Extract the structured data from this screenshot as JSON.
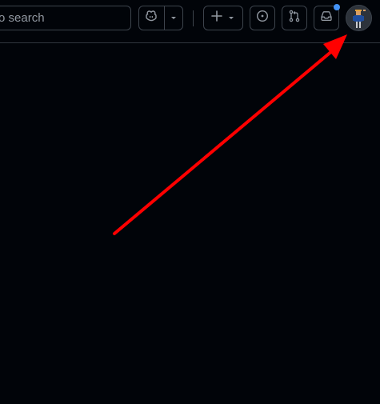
{
  "header": {
    "search": {
      "visible_text": "o search"
    },
    "buttons": {
      "copilot_icon": "copilot-icon",
      "copilot_menu_icon": "triangle-down-icon",
      "create_icon": "plus-icon",
      "create_menu_icon": "triangle-down-icon",
      "issues_icon": "issue-opened-icon",
      "pull_requests_icon": "git-pull-request-icon",
      "inbox_icon": "inbox-icon"
    },
    "notification_indicator": true
  },
  "colors": {
    "background": "#010409",
    "border": "#3d444d",
    "icon": "#9198a1",
    "notification_dot": "#4493f8",
    "annotation_arrow": "#ff0000"
  }
}
